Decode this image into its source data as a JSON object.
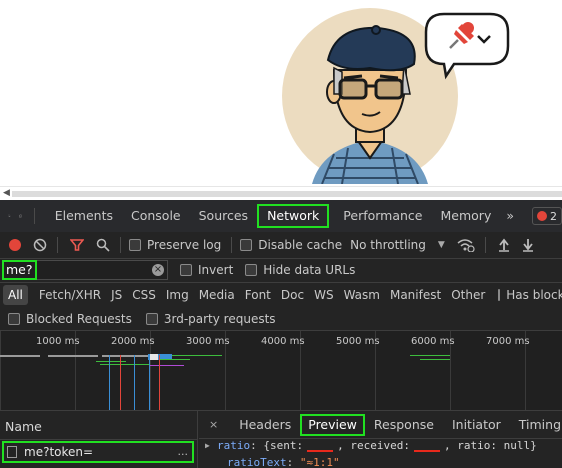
{
  "devtools": {
    "tabs": [
      "Elements",
      "Console",
      "Sources",
      "Network",
      "Performance",
      "Memory"
    ],
    "active_tab": "Network",
    "more_tabs_glyph": "»",
    "error_count": "2"
  },
  "toolbar": {
    "preserve_log": "Preserve log",
    "disable_cache": "Disable cache",
    "throttling": "No throttling"
  },
  "filter": {
    "value": "me?",
    "invert": "Invert",
    "hide_data_urls": "Hide data URLs"
  },
  "types": [
    "All",
    "Fetch/XHR",
    "JS",
    "CSS",
    "Img",
    "Media",
    "Font",
    "Doc",
    "WS",
    "Wasm",
    "Manifest",
    "Other"
  ],
  "has_blocked": "Has blocked coo",
  "blocked_requests": "Blocked Requests",
  "third_party": "3rd-party requests",
  "timeline": {
    "ticks": [
      "1000 ms",
      "2000 ms",
      "3000 ms",
      "4000 ms",
      "5000 ms",
      "6000 ms",
      "7000 ms"
    ]
  },
  "requests": {
    "header": "Name",
    "items": [
      {
        "name": "me?token=",
        "more": "..."
      }
    ]
  },
  "details": {
    "tabs": [
      "Headers",
      "Preview",
      "Response",
      "Initiator",
      "Timing"
    ],
    "active_tab": "Preview",
    "line1": {
      "key": "ratio",
      "sent_label": "{sent:",
      "received_label": "received:",
      "ratio_label": "ratio:",
      "ratio_value": "null}"
    },
    "line2": {
      "key": "ratioText",
      "value": "\"≈1:1\""
    }
  },
  "colors": {
    "highlight": "#21e021",
    "record": "#e2453a",
    "redaction": "#e8291c"
  }
}
